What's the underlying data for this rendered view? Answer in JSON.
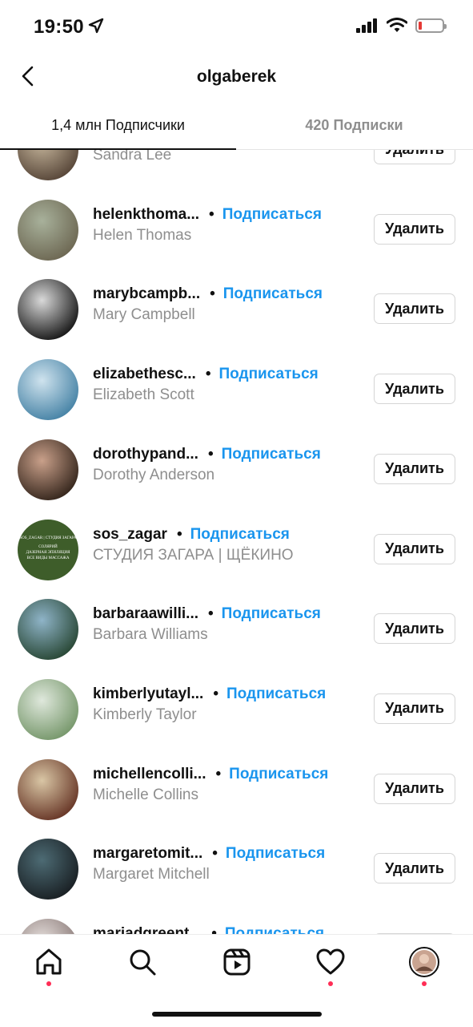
{
  "status_bar": {
    "time": "19:50",
    "battery_level": 0.1
  },
  "header": {
    "title": "olgaberek"
  },
  "tabs": [
    {
      "label": "1,4 млн Подписчики",
      "active": true
    },
    {
      "label": "420 Подписки",
      "active": false
    }
  ],
  "follow_label": "Подписаться",
  "remove_label": "Удалить",
  "followers": [
    {
      "username": "",
      "full_name": "Sandra Lee",
      "avatar_colors": [
        "#5b4a3c",
        "#c8b89e"
      ]
    },
    {
      "username": "helenkthoma...",
      "full_name": "Helen Thomas",
      "avatar_colors": [
        "#6f6a55",
        "#a8b19b"
      ]
    },
    {
      "username": "marybcampb...",
      "full_name": "Mary Campbell",
      "avatar_colors": [
        "#1e1e1e",
        "#d9d9d9"
      ]
    },
    {
      "username": "elizabethesc...",
      "full_name": "Elizabeth Scott",
      "avatar_colors": [
        "#4b86a8",
        "#cfe3ee"
      ]
    },
    {
      "username": "dorothypand...",
      "full_name": "Dorothy Anderson",
      "avatar_colors": [
        "#3a2a20",
        "#c9a08a"
      ]
    },
    {
      "username": "sos_zagar",
      "full_name": "СТУДИЯ ЗАГАРА | ЩЁКИНО",
      "avatar_colors": [
        "#3e5d2a",
        "#567a3b"
      ]
    },
    {
      "username": "barbaraawilli...",
      "full_name": "Barbara Williams",
      "avatar_colors": [
        "#2c4b3a",
        "#8fb4c8"
      ]
    },
    {
      "username": "kimberlyutayl...",
      "full_name": "Kimberly Taylor",
      "avatar_colors": [
        "#7a9a6f",
        "#dfe8dc"
      ]
    },
    {
      "username": "michellencolli...",
      "full_name": "Michelle Collins",
      "avatar_colors": [
        "#6b3b2b",
        "#d9c6a5"
      ]
    },
    {
      "username": "margaretomit...",
      "full_name": "Margaret Mitchell",
      "avatar_colors": [
        "#1b2226",
        "#4d6b74"
      ]
    },
    {
      "username": "mariadgreent...",
      "full_name": "",
      "avatar_colors": [
        "#8a7a78",
        "#e3dcd9"
      ]
    }
  ],
  "avatar_text": {
    "top": "SOS_ZAGAR | СТУДИЯ ЗАГАРА",
    "line1": "СОЛЯРИЙ",
    "line2": "ДАЗЕРНАЯ ЭПИЛЯЦИЯ",
    "line3": "ВСЕ ВИДЫ МАССАЖА"
  },
  "tab_bar": [
    {
      "name": "home-icon",
      "notification": true
    },
    {
      "name": "search-icon",
      "notification": false
    },
    {
      "name": "reels-icon",
      "notification": false
    },
    {
      "name": "heart-icon",
      "notification": true
    },
    {
      "name": "profile-avatar",
      "notification": true
    }
  ],
  "colors": {
    "accent": "#1a95ee",
    "secondary_text": "#8e8e8e",
    "notification": "#ff2d55"
  }
}
